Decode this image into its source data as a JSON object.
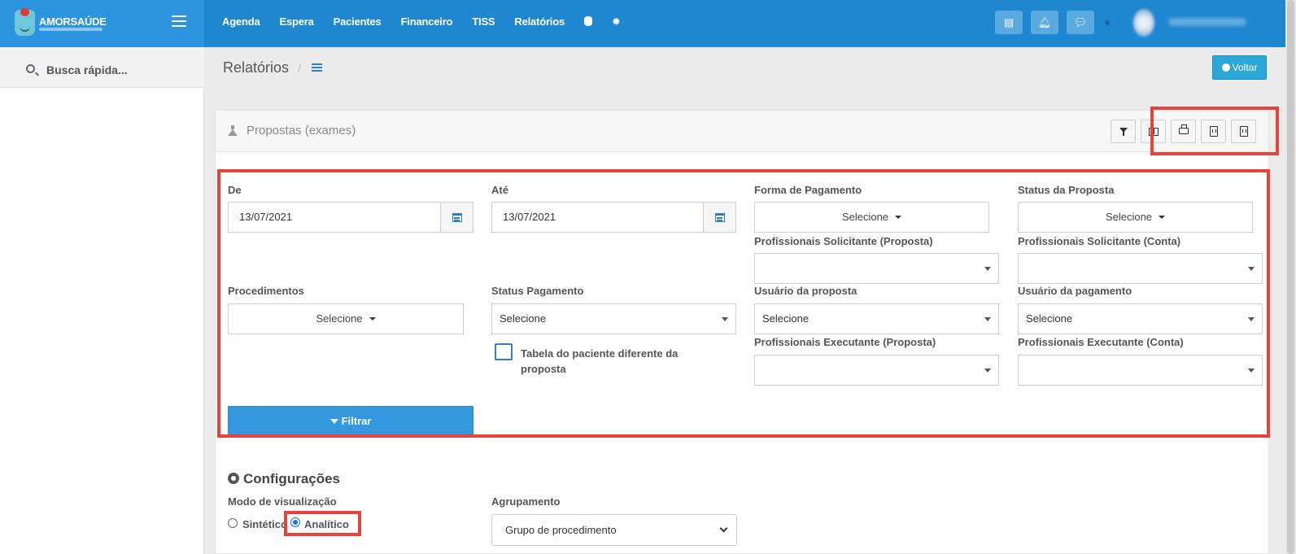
{
  "brand": {
    "name": "AMORSAÚDE"
  },
  "nav": [
    "Agenda",
    "Espera",
    "Pacientes",
    "Financeiro",
    "TISS",
    "Relatórios"
  ],
  "sidebar": {
    "search_label": "Busca rápida..."
  },
  "page": {
    "title": "Relatórios",
    "separator": "/",
    "back_label": "Voltar"
  },
  "panel": {
    "title": "Propostas (exames)"
  },
  "filters": {
    "de": {
      "label": "De",
      "value": "13/07/2021"
    },
    "ate": {
      "label": "Até",
      "value": "13/07/2021"
    },
    "forma_pagamento": {
      "label": "Forma de Pagamento",
      "value": "Selecione"
    },
    "status_proposta": {
      "label": "Status da Proposta",
      "value": "Selecione"
    },
    "prof_sol_proposta": {
      "label": "Profissionais Solicitante (Proposta)",
      "value": ""
    },
    "prof_sol_conta": {
      "label": "Profissionais Solicitante (Conta)",
      "value": ""
    },
    "procedimentos": {
      "label": "Procedimentos",
      "value": "Selecione"
    },
    "status_pagamento": {
      "label": "Status Pagamento",
      "value": "Selecione"
    },
    "usuario_proposta": {
      "label": "Usuário da proposta",
      "value": "Selecione"
    },
    "usuario_pagamento": {
      "label": "Usuário da pagamento",
      "value": "Selecione"
    },
    "tabela_diferente": {
      "label": "Tabela do paciente diferente da proposta",
      "checked": false
    },
    "prof_exec_proposta": {
      "label": "Profissionais Executante (Proposta)",
      "value": ""
    },
    "prof_exec_conta": {
      "label": "Profissionais Executante (Conta)",
      "value": ""
    },
    "submit_label": "Filtrar"
  },
  "config": {
    "title": "Configurações",
    "modo_label": "Modo de visualização",
    "modo_options": [
      "Sintético",
      "Analítico"
    ],
    "modo_selected": "Analítico",
    "agrupamento_label": "Agrupamento",
    "agrupamento_value": "Grupo de procedimento"
  },
  "colors": {
    "topbar": "#1f87cf",
    "primary": "#3398dc",
    "highlight": "#e8433a"
  }
}
